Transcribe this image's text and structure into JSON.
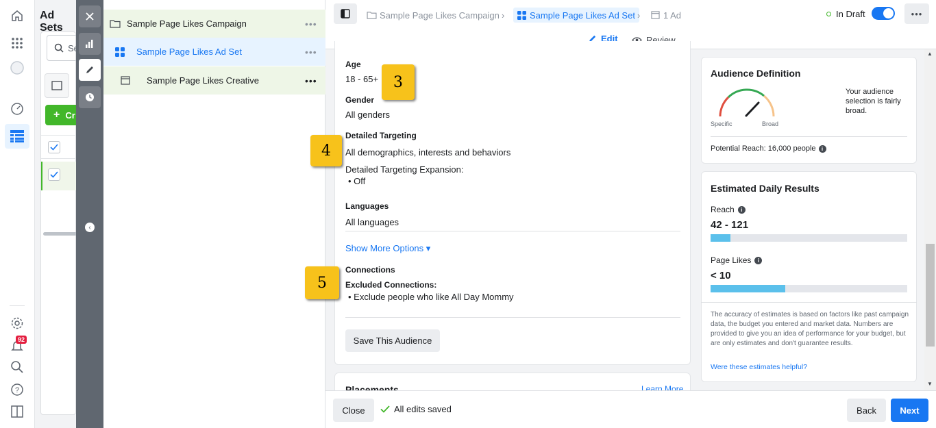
{
  "nav": {
    "behind_title": "Ad Sets",
    "behind_search_placeholder": "Se",
    "behind_create": "Cr",
    "notification_count": "92"
  },
  "tree": {
    "campaign": "Sample Page Likes Campaign",
    "ad_set": "Sample Page Likes Ad Set",
    "creative": "Sample Page Likes Creative",
    "more": "•••"
  },
  "breadcrumb": {
    "campaign": "Sample Page Likes Campaign",
    "ad_set": "Sample Page Likes Ad Set",
    "ad": "1 Ad",
    "status": "In Draft"
  },
  "tabs": {
    "edit": "Edit",
    "review": "Review"
  },
  "audience": {
    "age_label": "Age",
    "age_value": "18 - 65+",
    "gender_label": "Gender",
    "gender_value": "All genders",
    "detailed_label": "Detailed Targeting",
    "detailed_value": "All demographics, interests and behaviors",
    "expansion_label": "Detailed Targeting Expansion:",
    "expansion_value": "Off",
    "languages_label": "Languages",
    "languages_value": "All languages",
    "show_more": "Show More Options ▾",
    "connections_label": "Connections",
    "excluded_label": "Excluded Connections:",
    "excluded_value": "Exclude people who like All Day Mommy",
    "save_button": "Save This Audience",
    "placements_label": "Placements",
    "learn_more": "Learn More"
  },
  "markers": {
    "m3": "3",
    "m4": "4",
    "m5": "5"
  },
  "definition": {
    "title": "Audience Definition",
    "specific": "Specific",
    "broad": "Broad",
    "description": "Your audience selection is fairly broad.",
    "potential_reach": "Potential Reach: 16,000 people"
  },
  "results": {
    "title": "Estimated Daily Results",
    "reach_label": "Reach",
    "reach_value": "42 - 121",
    "reach_fill_fraction": 0.1,
    "likes_label": "Page Likes",
    "likes_value": "< 10",
    "likes_fill_fraction": 0.38,
    "disclaimer": "The accuracy of estimates is based on factors like past campaign data, the budget you entered and market data. Numbers are provided to give you an idea of performance for your budget, but are only estimates and don't guarantee results.",
    "helpful_link": "Were these estimates helpful?"
  },
  "footer": {
    "close": "Close",
    "saved": "All edits saved",
    "back": "Back",
    "next": "Next"
  },
  "colors": {
    "accent": "#1877f2",
    "tree_green": "#eef6e7",
    "tree_blue": "#e7f3ff",
    "marker": "#f7c21b"
  },
  "icons": [
    "home-icon",
    "apps-icon",
    "avatar-icon",
    "dashboard-icon",
    "table-icon",
    "settings-icon",
    "bell-icon",
    "search-icon",
    "help-icon",
    "sidebar-icon",
    "close-icon",
    "chart-icon",
    "pencil-icon",
    "clock-icon",
    "folder-icon",
    "adset-icon",
    "ad-icon",
    "eye-icon",
    "info-icon",
    "check-icon"
  ]
}
